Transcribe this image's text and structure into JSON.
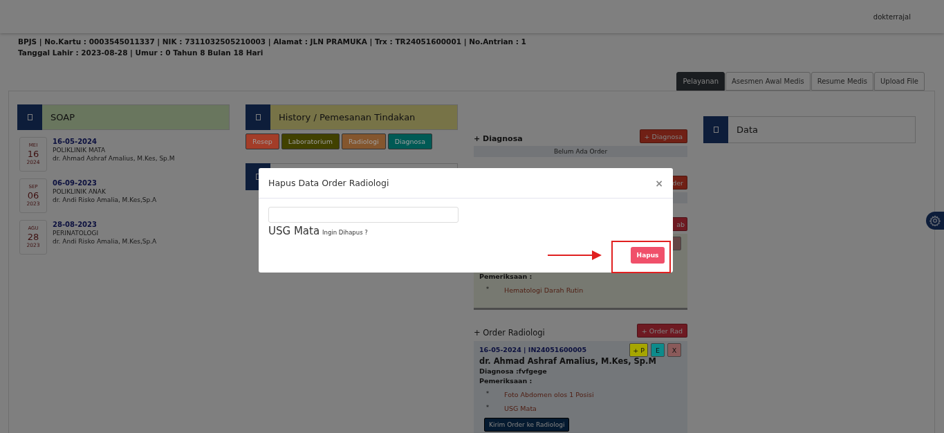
{
  "topbar": {
    "user": "dokterrajal"
  },
  "patient": {
    "lines": [
      "BPJS | No.Kartu : 0003545011337 | NIK : 7311032505210003 | Alamat : JLN PRAMUKA | Trx : TR24051600001 | No.Antrian : 1",
      "Tanggal Lahir : 2023-08-28 | Umur : 0 Tahun 8 Bulan 18 Hari"
    ]
  },
  "tabs": [
    {
      "label": "Pelayanan",
      "selected": true
    },
    {
      "label": "Asesmen Awal Medis",
      "selected": false
    },
    {
      "label": "Resume Medis",
      "selected": false
    },
    {
      "label": "Upload File",
      "selected": false
    }
  ],
  "soap": {
    "title": "SOAP",
    "visits": [
      {
        "month": "MEI",
        "day": "16",
        "year": "2024",
        "date": "16-05-2024",
        "clinic": "POLIKLINIK MATA",
        "doctor": "dr. Ahmad Ashraf Amalius, M.Kes, Sp.M"
      },
      {
        "month": "SEP",
        "day": "06",
        "year": "2023",
        "date": "06-09-2023",
        "clinic": "POLIKLINIK ANAK",
        "doctor": "dr. Andi Risko Amalia, M.Kes,Sp.A"
      },
      {
        "month": "AGU",
        "day": "28",
        "year": "2023",
        "date": "28-08-2023",
        "clinic": "PERINATOLOGI",
        "doctor": "dr. Andi Risko Amalia, M.Kes,Sp.A"
      }
    ]
  },
  "history": {
    "title": "History / Pemesanan Tindakan",
    "buttons": [
      {
        "label": "Resep",
        "color": "#a33d28"
      },
      {
        "label": "Laboratorium",
        "color": "#414100"
      },
      {
        "label": "Radiologi",
        "color": "#84562e"
      },
      {
        "label": "Diagnosa",
        "color": "#005a55"
      }
    ]
  },
  "orders": {
    "diagnosa": {
      "heading": "+ Diagnosa",
      "button": "+ Diagnosa",
      "empty": "Belum Ada Order"
    },
    "resep": {
      "button": "der"
    },
    "lab": {
      "button": "ab",
      "exam_label": "Pemeriksaan :",
      "bullet": "*",
      "items": [
        "Hematologi Darah Rutin"
      ]
    },
    "radiologi": {
      "heading": "+ Order Radiologi",
      "button": "+ Order Rad",
      "order": "16-05-2024 | IN24051600005",
      "doctor": "dr. Ahmad Ashraf Amalius, M.Kes, Sp.M",
      "diagnosis": "Diagnosa :fvfgege",
      "exam_label": "Pemeriksaan :",
      "bullet": "*",
      "items": [
        "Foto Abdomen olos 1 Posisi",
        "USG Mata"
      ],
      "actions": [
        {
          "label": "+ P",
          "color": "#a6a600"
        },
        {
          "label": "E",
          "color": "#0d8b8b"
        },
        {
          "label": "X",
          "color": "#8a5a5a"
        }
      ],
      "send_button": "Kirim Order ke Radiologi"
    }
  },
  "data_panel": {
    "title": "Data"
  },
  "modal": {
    "title": "Hapus Data Order Radiologi",
    "close": "×",
    "item": "USG Mata",
    "question": "Ingin Dihapus ?",
    "button": "Hapus"
  }
}
